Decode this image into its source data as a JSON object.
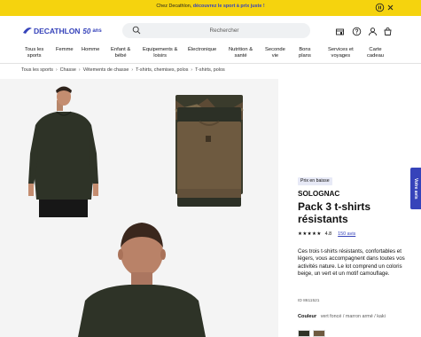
{
  "promo": {
    "text_prefix": "Chez Decathlon, ",
    "text_highlight": "découvrez le sport à prix juste !",
    "pause_icon": "pause-icon",
    "close_icon": "close-icon"
  },
  "header": {
    "logo_text": "DECATHLON",
    "logo_badge": "50",
    "logo_suffix": "ans",
    "search_placeholder": "Rechercher",
    "icons": [
      "store-icon",
      "help-icon",
      "user-icon",
      "cart-icon"
    ]
  },
  "nav": {
    "items": [
      {
        "label": "Tous les\nsports"
      },
      {
        "label": "Femme"
      },
      {
        "label": "Homme"
      },
      {
        "label": "Enfant &\nbébé"
      },
      {
        "label": "Equipements &\nloisirs"
      },
      {
        "label": "Électronique"
      },
      {
        "label": "Nutrition &\nsanté"
      },
      {
        "label": "Seconde\nvie"
      },
      {
        "label": "Bons\nplans"
      },
      {
        "label": "Services et\nvoyages"
      },
      {
        "label": "Carte\ncadeau"
      }
    ]
  },
  "breadcrumb": [
    "Tous les sports",
    "Chasse",
    "Vêtements de chasse",
    "T-shirts, chemises, polos",
    "T-shirts, polos"
  ],
  "product": {
    "badge": "Prix en baisse",
    "brand": "SOLOGNAC",
    "title": "Pack 3 t-shirts résistants",
    "rating": "4.8",
    "reviews": "150 avis",
    "description": "Ces trois t-shirts résistants, confortables et légers, vous accompagnent dans toutes vos activités nature. Le lot comprend un coloris beige, un vert et un motif camouflage.",
    "ref": "ID 8611521",
    "color_label": "Couleur",
    "color_value": "vert foncé / marron armé / kaki"
  },
  "side_tab": "Votre avis",
  "colors": {
    "brand_blue": "#3643ba",
    "promo_yellow": "#f5d30e",
    "shirt_green": "#2e3327",
    "shirt_brown": "#6e5a40",
    "gallery_bg": "#f4f4f4"
  }
}
